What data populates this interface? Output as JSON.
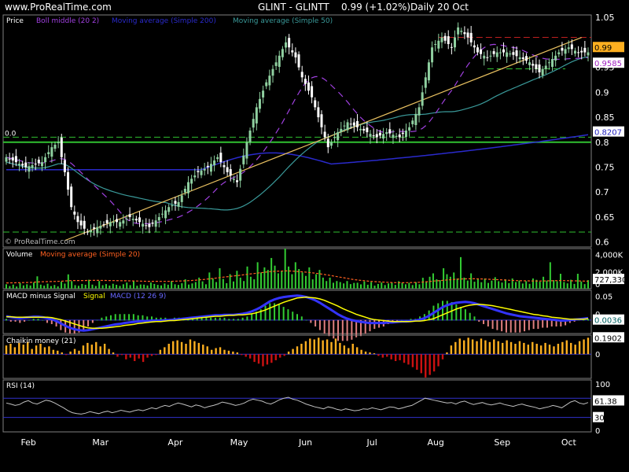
{
  "header": {
    "site": "www.ProRealTime.com",
    "symbol": "GLINT - GLINTT",
    "last": "0.99 (+1.02%)",
    "period": "Daily  20 Oct"
  },
  "colors": {
    "background": "#000000",
    "candle_up": "#8fd0a0",
    "candle_down": "#ffffff",
    "boll_middle": "#a040e0",
    "ma200": "#2a2acc",
    "ma50": "#3a9a9a",
    "trendline": "#e8c060",
    "resistance": "#c02020",
    "support": "#30c030",
    "volume_bar": "#33cc33",
    "volume_ma": "#ff6020",
    "macd": "#3333ff",
    "signal": "#ffff00",
    "chaikin_pos": "#ffb020",
    "chaikin_neg": "#cc1111",
    "rsi": "#c0c0c0"
  },
  "chart_data": [
    {
      "type": "candlestick",
      "panel": "price",
      "title": "Price",
      "indicators": [
        "Boll middle (20 2)",
        "Moving average (Simple 200)",
        "Moving average (Simple 50)"
      ],
      "x_months": [
        "Feb",
        "Mar",
        "Apr",
        "May",
        "Jun",
        "Jul",
        "Aug",
        "Sep",
        "Oct"
      ],
      "yticks": [
        "1.05",
        "0.95",
        "0.9",
        "0.85",
        "0.8",
        "0.75",
        "0.7",
        "0.65",
        "0.6"
      ],
      "ylim": [
        0.59,
        1.055
      ],
      "level_label": "0.0",
      "watermark": "© ProRealTime.com",
      "badges": [
        {
          "text": "0.99",
          "value": 0.99,
          "color": "#ffb020",
          "text_color": "#000"
        },
        {
          "text": "0.9585",
          "value": 0.9585,
          "color": "#ffffff",
          "text_color": "#a020c0"
        },
        {
          "text": "0.8207",
          "value": 0.8207,
          "color": "#ffffff",
          "text_color": "#2020c0"
        }
      ],
      "lines": {
        "resistance": 1.01,
        "support_upper": 0.81,
        "support_main": 0.8,
        "support_lower": 0.62,
        "support_mid": 0.947,
        "trend_start": {
          "day": 18,
          "value": 0.603
        },
        "trend_end": {
          "day": 177,
          "value": 1.01
        }
      },
      "anchors": [
        [
          0,
          0.77
        ],
        [
          6,
          0.75
        ],
        [
          11,
          0.76
        ],
        [
          14,
          0.79
        ],
        [
          16,
          0.8
        ],
        [
          18,
          0.74
        ],
        [
          20,
          0.67
        ],
        [
          22,
          0.64
        ],
        [
          25,
          0.62
        ],
        [
          28,
          0.63
        ],
        [
          32,
          0.64
        ],
        [
          35,
          0.64
        ],
        [
          38,
          0.65
        ],
        [
          41,
          0.64
        ],
        [
          44,
          0.63
        ],
        [
          47,
          0.65
        ],
        [
          50,
          0.67
        ],
        [
          53,
          0.68
        ],
        [
          56,
          0.72
        ],
        [
          59,
          0.74
        ],
        [
          62,
          0.75
        ],
        [
          65,
          0.77
        ],
        [
          68,
          0.74
        ],
        [
          71,
          0.72
        ],
        [
          74,
          0.8
        ],
        [
          77,
          0.87
        ],
        [
          80,
          0.92
        ],
        [
          83,
          0.96
        ],
        [
          86,
          1.0
        ],
        [
          89,
          0.97
        ],
        [
          91,
          0.93
        ],
        [
          94,
          0.89
        ],
        [
          97,
          0.83
        ],
        [
          99,
          0.79
        ],
        [
          102,
          0.82
        ],
        [
          105,
          0.84
        ],
        [
          108,
          0.83
        ],
        [
          111,
          0.82
        ],
        [
          114,
          0.81
        ],
        [
          117,
          0.82
        ],
        [
          121,
          0.81
        ],
        [
          124,
          0.83
        ],
        [
          127,
          0.87
        ],
        [
          129,
          0.93
        ],
        [
          131,
          0.99
        ],
        [
          134,
          1.01
        ],
        [
          137,
          0.99
        ],
        [
          139,
          1.03
        ],
        [
          142,
          1.01
        ],
        [
          145,
          0.98
        ],
        [
          148,
          0.97
        ],
        [
          151,
          0.98
        ],
        [
          154,
          0.98
        ],
        [
          158,
          0.97
        ],
        [
          161,
          0.96
        ],
        [
          164,
          0.94
        ],
        [
          167,
          0.96
        ],
        [
          170,
          0.98
        ],
        [
          173,
          0.99
        ],
        [
          176,
          0.98
        ]
      ]
    },
    {
      "type": "bar",
      "panel": "volume",
      "title": "Volume",
      "indicators": [
        "Moving average (Simple 20)"
      ],
      "yticks": [
        "4,000K",
        "2,000K",
        "0"
      ],
      "ylim": [
        0,
        4700
      ],
      "badge": "727,330",
      "values_k": [
        520,
        310,
        480,
        260,
        650,
        390,
        520,
        380,
        720,
        1450,
        480,
        360,
        590,
        310,
        440,
        270,
        820,
        600,
        1680,
        880,
        420,
        340,
        560,
        460,
        1050,
        480,
        320,
        900,
        410,
        540,
        370,
        580,
        460,
        330,
        520,
        720,
        420,
        890,
        350,
        500,
        480,
        380,
        720,
        560,
        450,
        390,
        610,
        470,
        890,
        520,
        450,
        640,
        1100,
        490,
        620,
        780,
        1300,
        860,
        520,
        1900,
        1200,
        780,
        2400,
        1150,
        650,
        1700,
        850,
        2100,
        1300,
        900,
        2600,
        1400,
        1100,
        3100,
        1900,
        2500,
        2200,
        3600,
        2700,
        1800,
        2100,
        4700,
        2600,
        1700,
        3100,
        2300,
        1900,
        1500,
        2500,
        1100,
        1700,
        2200,
        1300,
        900,
        1300,
        700,
        900,
        780,
        620,
        900,
        540,
        680,
        700,
        510,
        850,
        470,
        780,
        360,
        560,
        720,
        430,
        620,
        700,
        450,
        880,
        700,
        520,
        680,
        430,
        760,
        520,
        1280,
        860,
        1400,
        1800,
        1100,
        1000,
        2400,
        1700,
        1400,
        1900,
        1200,
        3700,
        1300,
        950,
        1800,
        820,
        1100,
        760,
        1200,
        680,
        950,
        1350,
        880,
        720,
        1100,
        650,
        1200,
        780,
        950,
        610,
        880,
        570,
        1200,
        1040,
        820,
        1400,
        950,
        3100,
        1000,
        880,
        1750,
        780,
        630,
        1050,
        560,
        1750,
        840,
        540,
        1000
      ],
      "ma_k": [
        680,
        680,
        690,
        700,
        710,
        720,
        730,
        740,
        760,
        790,
        810,
        820,
        830,
        840,
        850,
        860,
        880,
        900,
        930,
        950,
        960,
        960,
        960,
        960,
        970,
        980,
        980,
        980,
        970,
        970,
        960,
        950,
        950,
        940,
        930,
        930,
        920,
        910,
        900,
        890,
        880,
        870,
        870,
        870,
        870,
        860,
        860,
        860,
        870,
        880,
        890,
        900,
        920,
        940,
        960,
        990,
        1020,
        1060,
        1100,
        1140,
        1190,
        1230,
        1280,
        1340,
        1380,
        1420,
        1470,
        1520,
        1560,
        1610,
        1660,
        1710,
        1760,
        1810,
        1860,
        1900,
        1950,
        2000,
        2030,
        2050,
        2060,
        2080,
        2080,
        2070,
        2050,
        2020,
        1990,
        1960,
        1920,
        1880,
        1830,
        1780,
        1720,
        1660,
        1600,
        1530,
        1460,
        1390,
        1320,
        1250,
        1180,
        1110,
        1050,
        1000,
        960,
        920,
        880,
        850,
        820,
        800,
        780,
        760,
        740,
        720,
        710,
        700,
        700,
        710,
        720,
        730,
        740,
        760,
        790,
        820,
        860,
        900,
        930,
        960,
        1000,
        1030,
        1060,
        1100,
        1120,
        1140,
        1150,
        1160,
        1160,
        1160,
        1150,
        1140,
        1130,
        1110,
        1090,
        1070,
        1050,
        1030,
        1010,
        990,
        970,
        950,
        940,
        930,
        920,
        910,
        900,
        900,
        900,
        910,
        920,
        930,
        940,
        950,
        960,
        950,
        940,
        930,
        920,
        910,
        900,
        890,
        880
      ]
    },
    {
      "type": "line",
      "panel": "macd",
      "title": "MACD minus Signal",
      "indicators": [
        "Signal",
        "MACD (12 26 9)"
      ],
      "yticks": [
        "0.05",
        "0"
      ],
      "ylim": [
        -0.028,
        0.062
      ],
      "badge": "0.0036",
      "macd": [
        0.008,
        0.006,
        0.005,
        0.004,
        0.005,
        0.006,
        0.007,
        0.007,
        0.006,
        0.004,
        0.002,
        -0.002,
        -0.007,
        -0.012,
        -0.016,
        -0.019,
        -0.021,
        -0.022,
        -0.021,
        -0.019,
        -0.017,
        -0.015,
        -0.013,
        -0.011,
        -0.009,
        -0.008,
        -0.006,
        -0.005,
        -0.004,
        -0.003,
        -0.002,
        -0.002,
        -0.001,
        -0.001,
        -0.001,
        0.0,
        0.0,
        0.001,
        0.002,
        0.003,
        0.004,
        0.005,
        0.006,
        0.007,
        0.008,
        0.009,
        0.01,
        0.01,
        0.011,
        0.011,
        0.011,
        0.012,
        0.013,
        0.015,
        0.018,
        0.022,
        0.027,
        0.033,
        0.039,
        0.043,
        0.046,
        0.048,
        0.049,
        0.05,
        0.051,
        0.05,
        0.048,
        0.045,
        0.041,
        0.036,
        0.03,
        0.024,
        0.018,
        0.012,
        0.007,
        0.003,
        0.0,
        -0.002,
        -0.004,
        -0.005,
        -0.006,
        -0.006,
        -0.006,
        -0.006,
        -0.005,
        -0.005,
        -0.004,
        -0.003,
        -0.003,
        -0.002,
        -0.001,
        0.001,
        0.004,
        0.009,
        0.015,
        0.021,
        0.027,
        0.031,
        0.034,
        0.036,
        0.037,
        0.038,
        0.037,
        0.035,
        0.032,
        0.029,
        0.026,
        0.023,
        0.02,
        0.017,
        0.014,
        0.012,
        0.01,
        0.008,
        0.007,
        0.006,
        0.005,
        0.004,
        0.003,
        0.002,
        0.001,
        0.0,
        -0.001,
        -0.001,
        0.0,
        0.001,
        0.002,
        0.003,
        0.004
      ],
      "signal": [
        0.007,
        0.007,
        0.006,
        0.006,
        0.006,
        0.006,
        0.006,
        0.006,
        0.006,
        0.006,
        0.005,
        0.003,
        0.001,
        -0.002,
        -0.005,
        -0.008,
        -0.011,
        -0.014,
        -0.016,
        -0.017,
        -0.017,
        -0.017,
        -0.016,
        -0.015,
        -0.014,
        -0.013,
        -0.011,
        -0.01,
        -0.009,
        -0.007,
        -0.006,
        -0.005,
        -0.004,
        -0.003,
        -0.003,
        -0.002,
        -0.001,
        -0.001,
        0.0,
        0.001,
        0.002,
        0.003,
        0.004,
        0.005,
        0.006,
        0.007,
        0.008,
        0.008,
        0.009,
        0.01,
        0.01,
        0.011,
        0.011,
        0.012,
        0.013,
        0.015,
        0.018,
        0.021,
        0.025,
        0.029,
        0.033,
        0.037,
        0.04,
        0.043,
        0.046,
        0.047,
        0.048,
        0.047,
        0.046,
        0.044,
        0.041,
        0.037,
        0.033,
        0.029,
        0.024,
        0.02,
        0.016,
        0.012,
        0.009,
        0.006,
        0.003,
        0.001,
        0.0,
        -0.001,
        -0.002,
        -0.003,
        -0.003,
        -0.003,
        -0.003,
        -0.003,
        -0.002,
        -0.002,
        -0.001,
        0.001,
        0.003,
        0.007,
        0.011,
        0.015,
        0.019,
        0.023,
        0.026,
        0.029,
        0.031,
        0.032,
        0.033,
        0.032,
        0.031,
        0.03,
        0.028,
        0.026,
        0.024,
        0.022,
        0.02,
        0.018,
        0.016,
        0.014,
        0.012,
        0.011,
        0.009,
        0.008,
        0.006,
        0.005,
        0.004,
        0.003,
        0.002,
        0.002,
        0.002,
        0.002,
        0.003
      ]
    },
    {
      "type": "bar",
      "panel": "chaikin",
      "title": "Chaikin money (21)",
      "yticks": [
        "0"
      ],
      "ylim": [
        -0.28,
        0.22
      ],
      "badge": "0.1902",
      "values": [
        0.1,
        0.12,
        0.08,
        0.13,
        0.11,
        0.14,
        0.06,
        0.1,
        0.12,
        0.08,
        0.09,
        0.05,
        0.04,
        0.02,
        -0.01,
        0.03,
        0.06,
        0.04,
        0.1,
        0.13,
        0.11,
        0.14,
        0.09,
        0.12,
        0.06,
        0.02,
        -0.03,
        -0.01,
        -0.06,
        -0.04,
        -0.08,
        -0.05,
        -0.09,
        -0.04,
        -0.02,
        -0.01,
        0.05,
        0.08,
        0.12,
        0.15,
        0.16,
        0.14,
        0.12,
        0.17,
        0.15,
        0.13,
        0.11,
        0.09,
        0.05,
        0.07,
        0.08,
        0.05,
        0.04,
        0.03,
        0.02,
        -0.01,
        -0.03,
        -0.05,
        -0.09,
        -0.11,
        -0.14,
        -0.12,
        -0.1,
        -0.07,
        -0.04,
        -0.02,
        0.03,
        0.06,
        0.09,
        0.12,
        0.15,
        0.18,
        0.17,
        0.19,
        0.16,
        0.17,
        0.14,
        0.18,
        0.13,
        0.1,
        0.07,
        0.12,
        0.08,
        0.05,
        0.03,
        0.02,
        0.01,
        -0.02,
        -0.04,
        -0.03,
        -0.06,
        -0.08,
        -0.07,
        -0.1,
        -0.12,
        -0.15,
        -0.18,
        -0.22,
        -0.27,
        -0.24,
        -0.2,
        -0.14,
        -0.06,
        0.02,
        0.1,
        0.14,
        0.18,
        0.16,
        0.19,
        0.17,
        0.15,
        0.18,
        0.16,
        0.14,
        0.17,
        0.15,
        0.13,
        0.16,
        0.14,
        0.12,
        0.15,
        0.13,
        0.11,
        0.14,
        0.12,
        0.1,
        0.13,
        0.11,
        0.09,
        0.12,
        0.14,
        0.16,
        0.13,
        0.11,
        0.15,
        0.17,
        0.19
      ]
    },
    {
      "type": "line",
      "panel": "rsi",
      "title": "RSI (14)",
      "yticks": [
        "100",
        "0"
      ],
      "ylim": [
        0,
        100
      ],
      "levels": [
        70,
        30
      ],
      "level_badge": "30",
      "badge": "61.38",
      "values": [
        60,
        58,
        55,
        57,
        62,
        65,
        60,
        58,
        62,
        66,
        64,
        60,
        55,
        50,
        44,
        40,
        38,
        37,
        39,
        42,
        40,
        38,
        41,
        43,
        40,
        42,
        45,
        43,
        41,
        44,
        46,
        44,
        47,
        50,
        48,
        52,
        55,
        53,
        57,
        60,
        58,
        55,
        52,
        56,
        54,
        50,
        53,
        55,
        58,
        62,
        60,
        58,
        55,
        57,
        60,
        65,
        68,
        66,
        64,
        60,
        58,
        62,
        67,
        70,
        72,
        68,
        66,
        62,
        58,
        55,
        52,
        50,
        48,
        52,
        50,
        47,
        45,
        48,
        46,
        44,
        45,
        48,
        47,
        50,
        48,
        46,
        49,
        52,
        51,
        48,
        50,
        53,
        55,
        60,
        65,
        70,
        68,
        66,
        64,
        62,
        60,
        61,
        58,
        62,
        64,
        60,
        57,
        59,
        61,
        58,
        56,
        58,
        60,
        57,
        55,
        53,
        56,
        58,
        55,
        53,
        51,
        48,
        50,
        52,
        55,
        53,
        50,
        56,
        62,
        65,
        60,
        58,
        61
      ]
    }
  ],
  "price_badges_hidden": []
}
